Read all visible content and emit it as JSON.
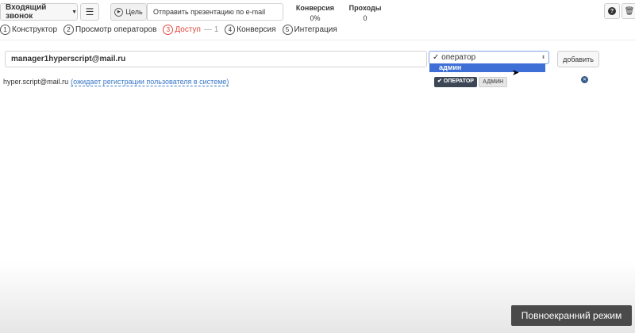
{
  "header": {
    "scenario_dropdown": "Входящий звонок",
    "goal_label": "Цель",
    "goal_value": "Отправить презентацию по e-mail",
    "stats": [
      {
        "label": "Конверсия",
        "value": "0%"
      },
      {
        "label": "Проходы",
        "value": "0"
      }
    ]
  },
  "steps": [
    {
      "num": "1",
      "label": "Конструктор"
    },
    {
      "num": "2",
      "label": "Просмотр операторов"
    },
    {
      "num": "3",
      "label": "Доступ",
      "extra": "— 1"
    },
    {
      "num": "4",
      "label": "Конверсия"
    },
    {
      "num": "5",
      "label": "Интеграция"
    }
  ],
  "access_form": {
    "email_value": "manager1hyperscript@mail.ru",
    "role_selected": "оператор",
    "role_options": [
      "оператор",
      "админ"
    ],
    "add_button": "добавить"
  },
  "users": [
    {
      "email": "hyper.script@mail.ru",
      "status": "(ожидает регистрации пользователя в системе)",
      "roles": [
        "✔ оператор",
        "админ"
      ]
    }
  ],
  "overlay": {
    "fullscreen_label": "Повноекранний режим"
  },
  "colors": {
    "active_step": "#e0483c",
    "dropdown_highlight": "#3d6fd6",
    "badge_dark": "#3c4654",
    "link": "#3a79c7"
  }
}
